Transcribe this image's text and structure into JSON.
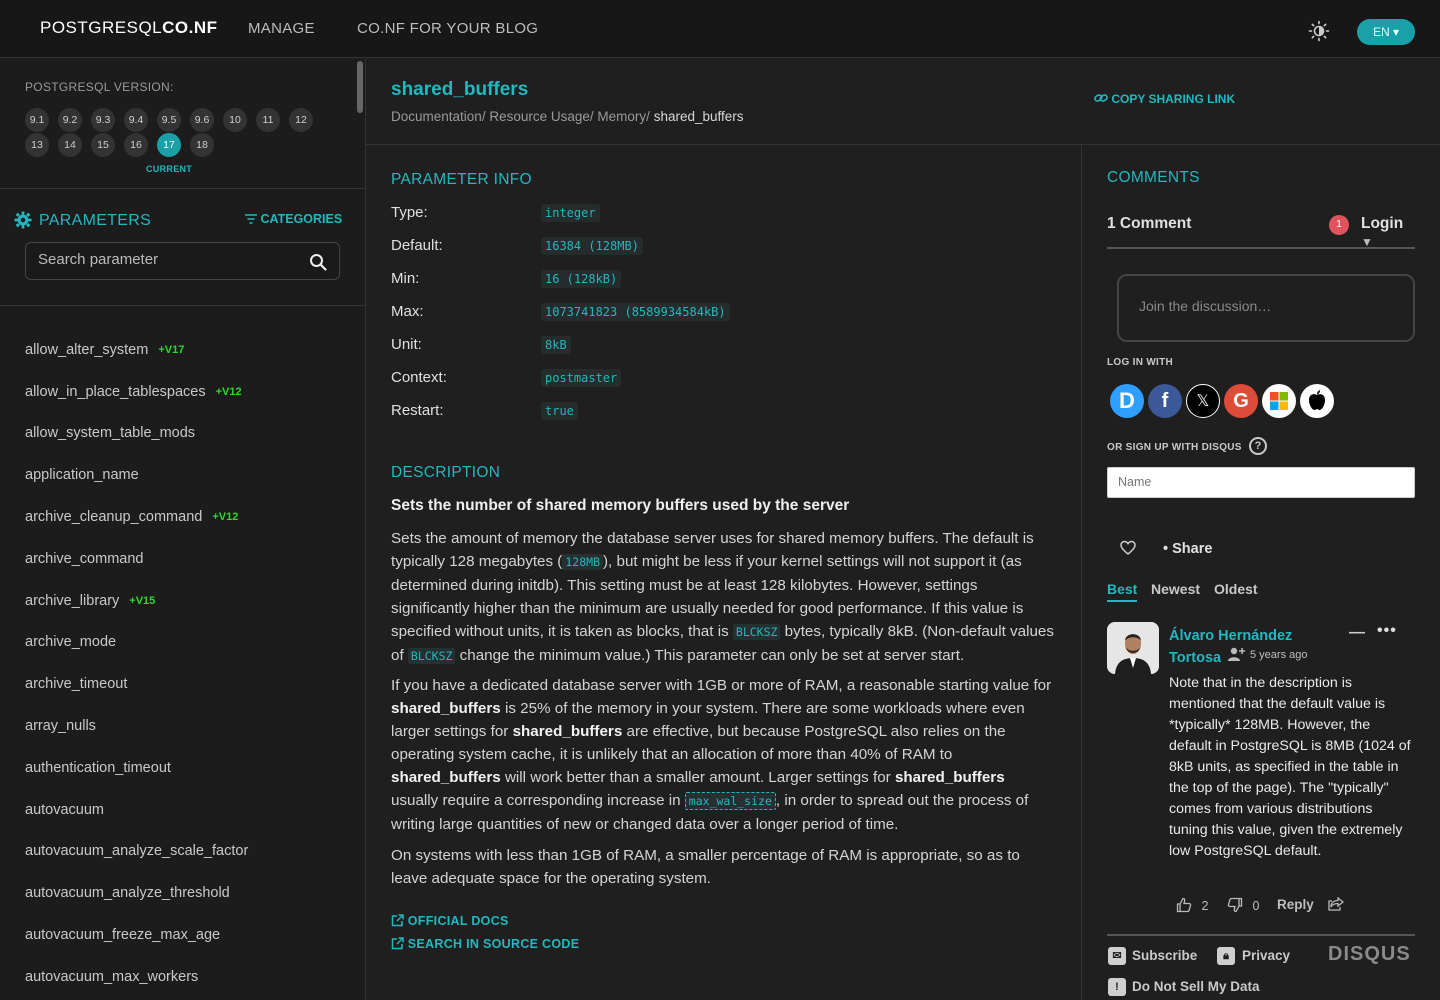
{
  "header": {
    "logo_main": "POSTGRESQL",
    "logo_bold": "CO.NF",
    "nav": [
      "MANAGE",
      "CO.NF FOR YOUR BLOG"
    ],
    "lang": "EN"
  },
  "sidebar": {
    "version_label": "POSTGRESQL VERSION:",
    "versions": [
      "9.1",
      "9.2",
      "9.3",
      "9.4",
      "9.5",
      "9.6",
      "10",
      "11",
      "12",
      "13",
      "14",
      "15",
      "16",
      "17",
      "18"
    ],
    "active_version": "17",
    "current_label": "CURRENT",
    "params_title": "PARAMETERS",
    "categories_label": "CATEGORIES",
    "search_placeholder": "Search parameter",
    "params": [
      {
        "name": "allow_alter_system",
        "badge": "+V17"
      },
      {
        "name": "allow_in_place_tablespaces",
        "badge": "+V12"
      },
      {
        "name": "allow_system_table_mods",
        "badge": ""
      },
      {
        "name": "application_name",
        "badge": ""
      },
      {
        "name": "archive_cleanup_command",
        "badge": "+V12"
      },
      {
        "name": "archive_command",
        "badge": ""
      },
      {
        "name": "archive_library",
        "badge": "+V15"
      },
      {
        "name": "archive_mode",
        "badge": ""
      },
      {
        "name": "archive_timeout",
        "badge": ""
      },
      {
        "name": "array_nulls",
        "badge": ""
      },
      {
        "name": "authentication_timeout",
        "badge": ""
      },
      {
        "name": "autovacuum",
        "badge": ""
      },
      {
        "name": "autovacuum_analyze_scale_factor",
        "badge": ""
      },
      {
        "name": "autovacuum_analyze_threshold",
        "badge": ""
      },
      {
        "name": "autovacuum_freeze_max_age",
        "badge": ""
      },
      {
        "name": "autovacuum_max_workers",
        "badge": ""
      }
    ]
  },
  "page": {
    "title": "shared_buffers",
    "breadcrumb": [
      "Documentation",
      "Resource Usage",
      "Memory",
      "shared_buffers"
    ],
    "copy_link": "COPY SHARING LINK",
    "info_heading": "PARAMETER INFO",
    "info": [
      {
        "k": "Type:",
        "v": "integer"
      },
      {
        "k": "Default:",
        "v": "16384 (128MB)"
      },
      {
        "k": "Min:",
        "v": "16 (128kB)"
      },
      {
        "k": "Max:",
        "v": "1073741823 (8589934584kB)"
      },
      {
        "k": "Unit:",
        "v": "8kB"
      },
      {
        "k": "Context:",
        "v": "postmaster"
      },
      {
        "k": "Restart:",
        "v": "true"
      }
    ],
    "desc_heading": "DESCRIPTION",
    "desc_short": "Sets the number of shared memory buffers used by the server",
    "p1": [
      "Sets the amount of memory the database server uses for shared memory buffers. The default is typically 128 megabytes (",
      "128MB",
      "), but might be less if your kernel settings will not support it (as determined during initdb). This setting must be at least 128 kilobytes. However, settings significantly higher than the minimum are usually needed for good performance. If this value is specified without units, it is taken as blocks, that is ",
      "BLCKSZ",
      " bytes, typically 8kB. (Non-default values of ",
      "BLCKSZ",
      " change the minimum value.) This parameter can only be set at server start."
    ],
    "p2": [
      "If you have a dedicated database server with 1GB or more of RAM, a reasonable starting value for ",
      "shared_buffers",
      " is 25% of the memory in your system. There are some workloads where even larger settings for ",
      "shared_buffers",
      " are effective, but because PostgreSQL also relies on the operating system cache, it is unlikely that an allocation of more than 40% of RAM to ",
      "shared_buffers",
      " will work better than a smaller amount. Larger settings for ",
      "shared_buffers",
      " usually require a corresponding increase in ",
      "max_wal_size",
      ", in order to spread out the process of writing large quantities of new or changed data over a longer period of time."
    ],
    "p3": "On systems with less than 1GB of RAM, a smaller percentage of RAM is appropriate, so as to leave adequate space for the operating system.",
    "official_docs": "OFFICIAL DOCS",
    "search_source": "SEARCH IN SOURCE CODE"
  },
  "comments": {
    "title": "COMMENTS",
    "count": "1 Comment",
    "notif": "1",
    "login": "Login",
    "discuss_placeholder": "Join the discussion…",
    "log_in_with": "LOG IN WITH",
    "sign_up": "OR SIGN UP WITH DISQUS",
    "help": "?",
    "name_placeholder": "Name",
    "share": "Share",
    "sort": [
      "Best",
      "Newest",
      "Oldest"
    ],
    "author": "Álvaro Hernández Tortosa",
    "time": "5 years ago",
    "body": "Note that in the description is mentioned that the default value is *typically* 128MB. However, the default in PostgreSQL is 8MB (1024 of 8kB units, as specified in the table in the top of the page). The \"typically\" comes from various distributions tuning this value, given the extremely low PostgreSQL default.",
    "upvotes": "2",
    "downvotes": "0",
    "reply": "Reply",
    "subscribe": "Subscribe",
    "privacy": "Privacy",
    "disqus": "DISQUS",
    "do_not_sell": "Do Not Sell My Data"
  },
  "colors": {
    "accent": "#22b8c0",
    "badge_green": "#2bd92b",
    "bg": "#1f1f1f"
  }
}
